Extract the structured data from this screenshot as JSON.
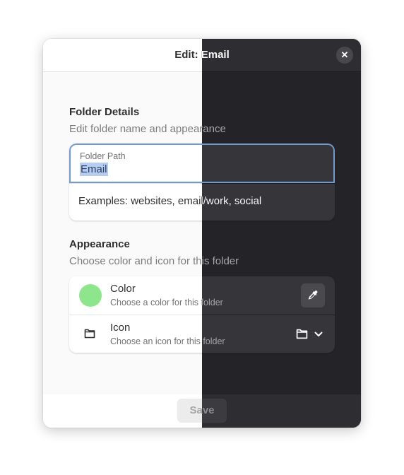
{
  "dialog": {
    "title": "Edit: Email",
    "close_symbol": "✕"
  },
  "folder_details": {
    "title": "Folder Details",
    "subtitle": "Edit folder name and appearance",
    "path_label": "Folder Path",
    "path_value": "Email",
    "examples": "Examples: websites, email/work, social"
  },
  "appearance": {
    "title": "Appearance",
    "subtitle": "Choose color and icon for this folder",
    "color_row": {
      "title": "Color",
      "subtitle": "Choose a color for this folder",
      "swatch_color": "#8ee68c",
      "button_icon": "color-picker-icon"
    },
    "icon_row": {
      "title": "Icon",
      "subtitle": "Choose an icon for this folder",
      "selected_icon": "folder-icon"
    }
  },
  "footer": {
    "save_label": "Save"
  }
}
